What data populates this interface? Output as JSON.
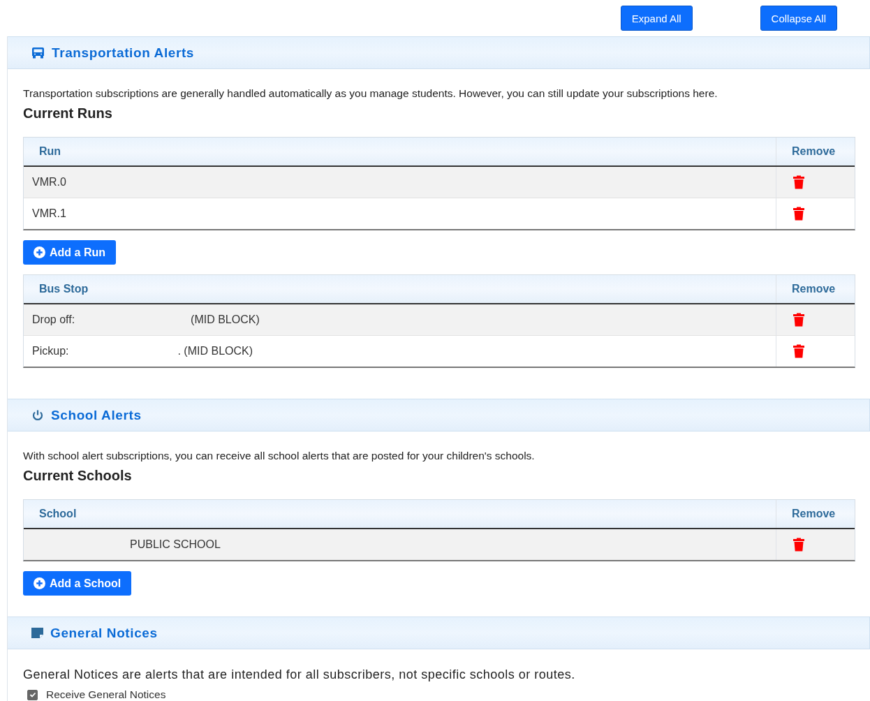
{
  "toolbar": {
    "buttons": [
      "Expand All",
      "Collapse All"
    ]
  },
  "sections": [
    {
      "kind": "transport",
      "title": "Transportation Alerts",
      "description": "Transportation subscriptions are generally handled automatically as you manage students. However, you can still update your subscriptions here.",
      "subheading": "Current Runs",
      "tables": [
        {
          "columns": [
            "Run",
            "Remove"
          ],
          "rows": [
            {
              "label": "VMR.0"
            },
            {
              "label": "VMR.1"
            }
          ],
          "add_button": "Add a Run"
        },
        {
          "columns": [
            "Bus Stop",
            "Remove"
          ],
          "rows": [
            {
              "label": "Drop off:",
              "detail": "(MID BLOCK)"
            },
            {
              "label": "Pickup:",
              "detail": ". (MID BLOCK)"
            }
          ]
        }
      ]
    },
    {
      "kind": "school",
      "title": "School Alerts",
      "description": "With school alert subscriptions, you can receive all school alerts that are posted for your children's schools.",
      "subheading": "Current Schools",
      "tables": [
        {
          "columns": [
            "School",
            "Remove"
          ],
          "rows": [
            {
              "detail": "PUBLIC SCHOOL"
            }
          ],
          "add_button": "Add a School"
        }
      ]
    },
    {
      "kind": "notices",
      "title": "General Notices",
      "description": "General Notices are alerts that are intended for all subscribers, not specific schools or routes.",
      "checkbox": {
        "label": "Receive General Notices",
        "checked": true
      }
    }
  ]
}
